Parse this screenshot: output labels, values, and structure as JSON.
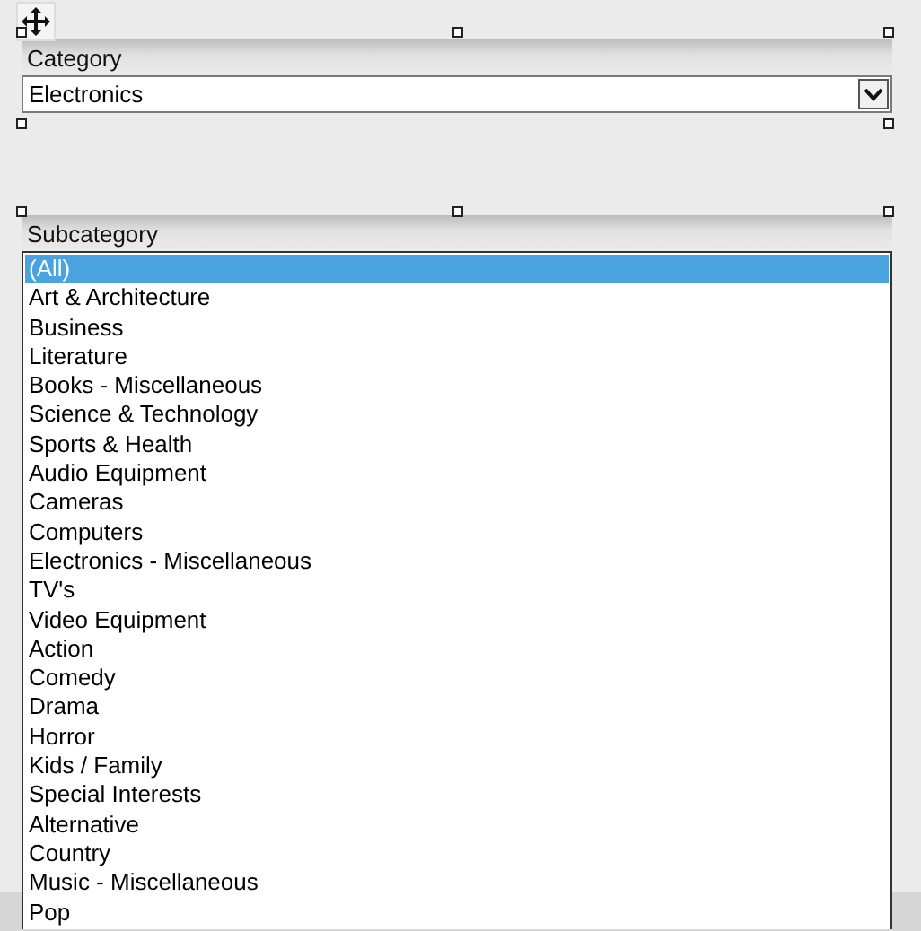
{
  "category": {
    "label": "Category",
    "value": "Electronics"
  },
  "subcategory": {
    "label": "Subcategory",
    "items": [
      {
        "label": "(All)",
        "selected": true
      },
      {
        "label": "Art & Architecture",
        "selected": false
      },
      {
        "label": "Business",
        "selected": false
      },
      {
        "label": "Literature",
        "selected": false
      },
      {
        "label": "Books - Miscellaneous",
        "selected": false
      },
      {
        "label": "Science & Technology",
        "selected": false
      },
      {
        "label": "Sports & Health",
        "selected": false
      },
      {
        "label": "Audio Equipment",
        "selected": false
      },
      {
        "label": "Cameras",
        "selected": false
      },
      {
        "label": "Computers",
        "selected": false
      },
      {
        "label": "Electronics - Miscellaneous",
        "selected": false
      },
      {
        "label": "TV's",
        "selected": false
      },
      {
        "label": "Video Equipment",
        "selected": false
      },
      {
        "label": "Action",
        "selected": false
      },
      {
        "label": "Comedy",
        "selected": false
      },
      {
        "label": "Drama",
        "selected": false
      },
      {
        "label": "Horror",
        "selected": false
      },
      {
        "label": "Kids / Family",
        "selected": false
      },
      {
        "label": "Special Interests",
        "selected": false
      },
      {
        "label": "Alternative",
        "selected": false
      },
      {
        "label": "Country",
        "selected": false
      },
      {
        "label": "Music - Miscellaneous",
        "selected": false
      },
      {
        "label": "Pop",
        "selected": false
      }
    ]
  }
}
